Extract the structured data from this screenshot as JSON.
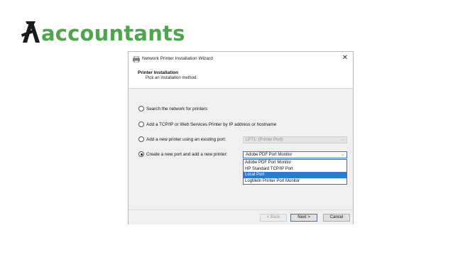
{
  "brand": {
    "logo_text": "accountants",
    "logo_color": "#4aa74a"
  },
  "window": {
    "title": "Network Printer Installation Wizard",
    "close_glyph": "✕"
  },
  "header": {
    "title": "Printer Installation",
    "subtitle": "Pick an installation method."
  },
  "options": [
    {
      "label": "Search the network for printers",
      "checked": false
    },
    {
      "label": "Add a TCP/IP or Web Services Printer by IP address or hostname",
      "checked": false
    },
    {
      "label": "Add a new printer using an existing port:",
      "checked": false
    },
    {
      "label": "Create a new port and add a new printer:",
      "checked": true
    }
  ],
  "existing_port_select": {
    "value": "LPT1: (Printer Port)",
    "disabled": true
  },
  "new_port_select": {
    "value": "Adobe PDF Port Monitor",
    "options": [
      "Adobe PDF Port Monitor",
      "HP Standard TCP/IP Port",
      "Local Port",
      "LogMeIn Printer Port Monitor"
    ],
    "highlighted": "Local Port"
  },
  "buttons": {
    "back": "< Back",
    "next": "Next >",
    "cancel": "Cancel"
  },
  "colors": {
    "accent": "#2a7bd4",
    "panel_bg": "#f0f0f0"
  }
}
